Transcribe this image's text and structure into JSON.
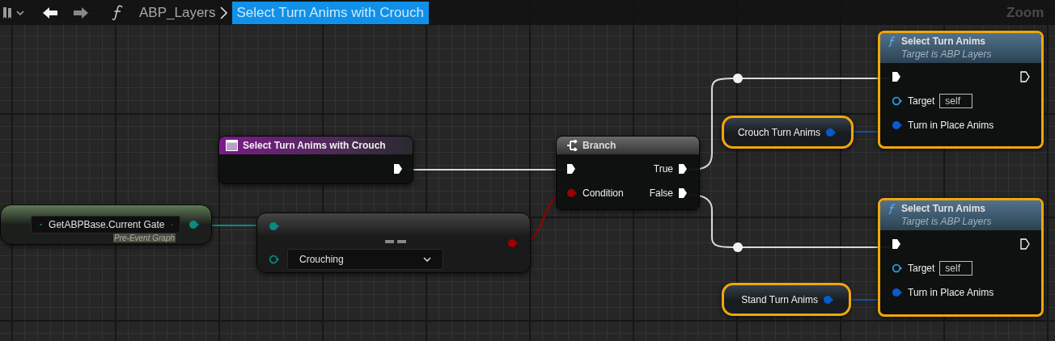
{
  "toolbar": {
    "breadcrumb": "ABP_Layers",
    "title": "Select Turn Anims with Crouch",
    "zoom_label": "Zoom"
  },
  "nodes": [
    {
      "kind": "function",
      "title": "Select Turn Anims",
      "subtitle": "Target is ABP Layers",
      "target_label": "Target",
      "target_value": "self",
      "param_label": "Turn in Place Anims",
      "selected": true
    },
    {
      "kind": "variable",
      "label": "Crouch Turn Anims",
      "selected": true
    },
    {
      "kind": "event",
      "title": "Select Turn Anims with Crouch",
      "selected": false
    },
    {
      "kind": "branch",
      "title": "Branch",
      "condition_label": "Condition",
      "true_label": "True",
      "false_label": "False",
      "selected": false
    },
    {
      "kind": "getter",
      "value": "GetABPBase.Current Gate",
      "context": "Pre-Event Graph",
      "selected": false
    },
    {
      "kind": "compare",
      "value": "Crouching",
      "selected": false
    },
    {
      "kind": "function",
      "title": "Select Turn Anims",
      "subtitle": "Target is ABP Layers",
      "target_label": "Target",
      "target_value": "self",
      "param_label": "Turn in Place Anims",
      "selected": true
    },
    {
      "kind": "variable",
      "label": "Stand Turn Anims",
      "selected": true
    }
  ]
}
